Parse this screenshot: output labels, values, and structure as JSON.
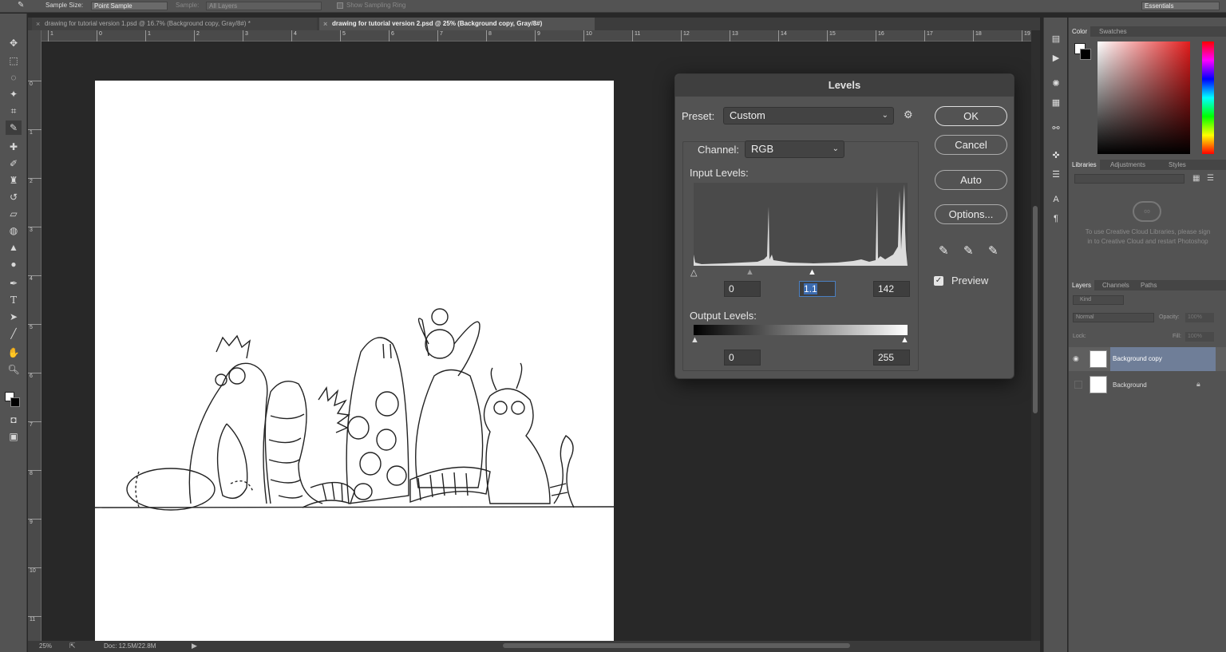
{
  "options_bar": {
    "sample_size_label": "Sample Size:",
    "sample_size_value": "Point Sample",
    "sample_label": "Sample:",
    "sample_value": "All Layers",
    "show_sampling_ring": "Show Sampling Ring",
    "workspace": "Essentials"
  },
  "tabs": [
    {
      "label": "drawing for tutorial version 1.psd @ 16.7% (Background copy, Gray/8#) *"
    },
    {
      "label": "drawing for tutorial version 2.psd @ 25% (Background copy, Gray/8#)"
    }
  ],
  "ruler_top": [
    "1",
    "0",
    "1",
    "2",
    "3",
    "4",
    "5",
    "6",
    "7",
    "8",
    "9",
    "10",
    "11",
    "12",
    "13",
    "14",
    "15",
    "16",
    "17",
    "18",
    "19"
  ],
  "ruler_left": [
    "0",
    "1",
    "2",
    "3",
    "4",
    "5",
    "6",
    "7",
    "8",
    "9",
    "10",
    "11"
  ],
  "status": {
    "zoom": "25%",
    "doc": "Doc: 12.5M/22.8M"
  },
  "levels": {
    "title": "Levels",
    "preset_label": "Preset:",
    "preset_value": "Custom",
    "channel_label": "Channel:",
    "channel_value": "RGB",
    "input_levels_label": "Input Levels:",
    "input_black": "0",
    "input_gamma": "1.1",
    "input_white": "142",
    "output_levels_label": "Output Levels:",
    "output_black": "0",
    "output_white": "255",
    "ok": "OK",
    "cancel": "Cancel",
    "auto": "Auto",
    "options": "Options...",
    "preview": "Preview",
    "preview_checked": true
  },
  "color_panel": {
    "tabs": [
      "Color",
      "Swatches"
    ]
  },
  "libraries_panel": {
    "tabs": [
      "Libraries",
      "Adjustments",
      "Styles"
    ],
    "message": "To use Creative Cloud Libraries, please sign in to Creative Cloud and restart Photoshop"
  },
  "layers_panel": {
    "tabs": [
      "Layers",
      "Channels",
      "Paths"
    ],
    "kind": "Kind",
    "blend_mode": "Normal",
    "opacity_label": "Opacity:",
    "opacity_value": "100%",
    "lock_label": "Lock:",
    "fill_label": "Fill:",
    "fill_value": "100%",
    "layers": [
      {
        "name": "Background copy",
        "selected": true,
        "visible": true
      },
      {
        "name": "Background",
        "selected": false,
        "visible": false,
        "locked": true
      }
    ]
  }
}
